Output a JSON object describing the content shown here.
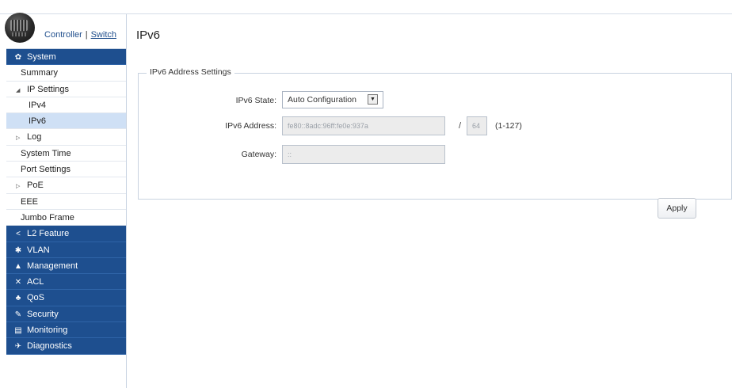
{
  "header": {
    "mode_controller": "Controller",
    "mode_separator": "|",
    "mode_switch": "Switch"
  },
  "sidebar": {
    "items": [
      {
        "label": "System",
        "icon": "gear-icon",
        "level": "top"
      },
      {
        "label": "Summary",
        "level": "sub"
      },
      {
        "label": "IP Settings",
        "level": "sub",
        "arrow": "expanded"
      },
      {
        "label": "IPv4",
        "level": "sub2"
      },
      {
        "label": "IPv6",
        "level": "sub2",
        "active": true
      },
      {
        "label": "Log",
        "level": "sub",
        "arrow": "collapsed"
      },
      {
        "label": "System Time",
        "level": "sub"
      },
      {
        "label": "Port Settings",
        "level": "sub"
      },
      {
        "label": "PoE",
        "level": "sub",
        "arrow": "collapsed"
      },
      {
        "label": "EEE",
        "level": "sub"
      },
      {
        "label": "Jumbo Frame",
        "level": "sub"
      },
      {
        "label": "L2 Feature",
        "icon": "share-icon",
        "level": "top"
      },
      {
        "label": "VLAN",
        "icon": "network-icon",
        "level": "top"
      },
      {
        "label": "Management",
        "icon": "user-icon",
        "level": "top"
      },
      {
        "label": "ACL",
        "icon": "shuffle-icon",
        "level": "top"
      },
      {
        "label": "QoS",
        "icon": "sitemap-icon",
        "level": "top"
      },
      {
        "label": "Security",
        "icon": "key-icon",
        "level": "top"
      },
      {
        "label": "Monitoring",
        "icon": "server-icon",
        "level": "top"
      },
      {
        "label": "Diagnostics",
        "icon": "tools-icon",
        "level": "top"
      }
    ]
  },
  "main": {
    "title": "IPv6",
    "section_title": "IPv6 Address Settings",
    "fields": {
      "state_label": "IPv6 State:",
      "state_value": "Auto Configuration",
      "address_label": "IPv6 Address:",
      "address_value": "fe80::8adc:96ff:fe0e:937a",
      "slash": "/",
      "prefix_value": "64",
      "prefix_range": "(1-127)",
      "gateway_label": "Gateway:",
      "gateway_value": "::"
    },
    "apply_label": "Apply"
  },
  "colors": {
    "nav_top_bg": "#1e4f8f",
    "nav_active_bg": "#cfe0f5",
    "link": "#1f4e8c"
  }
}
